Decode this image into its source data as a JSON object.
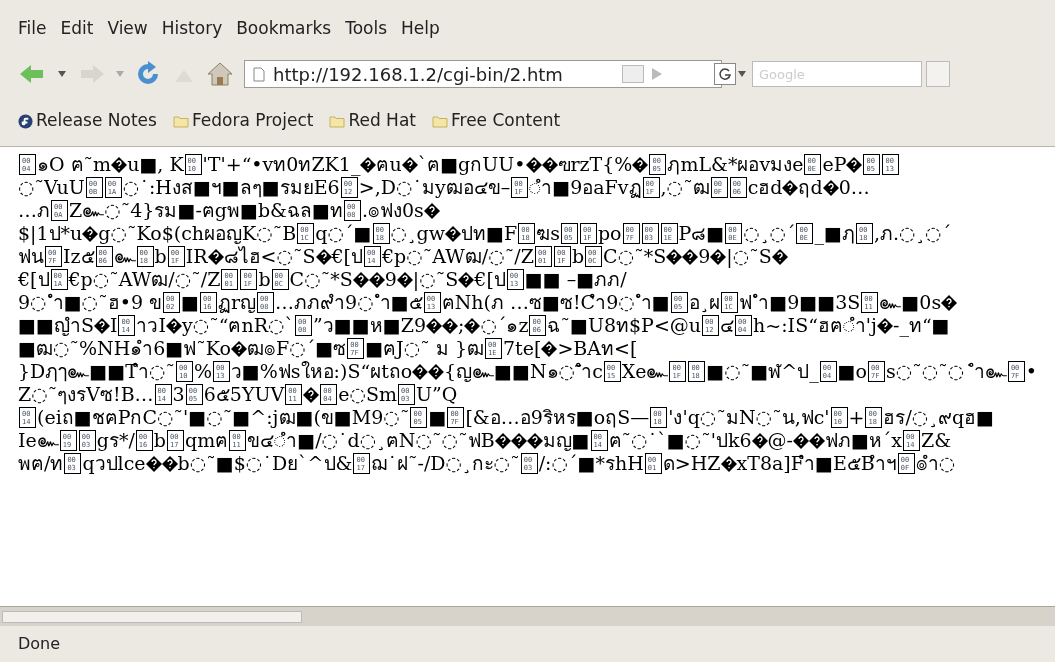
{
  "menu": [
    "File",
    "Edit",
    "View",
    "History",
    "Bookmarks",
    "Tools",
    "Help"
  ],
  "address": {
    "value": "http://192.168.1.2/cgi-bin/2.htm"
  },
  "search": {
    "placeholder": "Google"
  },
  "bookmarks": [
    {
      "label": "Release Notes",
      "kind": "fedora"
    },
    {
      "label": "Fedora Project",
      "kind": "folder"
    },
    {
      "label": "Red Hat",
      "kind": "folder"
    },
    {
      "label": "Free Content",
      "kind": "folder"
    }
  ],
  "lines": [
    [
      {
        "kind": "hex",
        "code": "0004"
      },
      "๑O ฅ˜m",
      {
        "kind": "bad"
      },
      "u■, K",
      {
        "kind": "hex",
        "code": "0010"
      },
      "'T'+“•vท0ทZK1_",
      {
        "kind": "bad"
      },
      "ฅu",
      {
        "kind": "bad"
      },
      "`ฅ■gกUU•",
      {
        "kind": "bad"
      },
      {
        "kind": "bad"
      },
      "ฃrzT{%",
      {
        "kind": "bad"
      },
      {
        "kind": "hex",
        "code": "0005"
      },
      "ฦmL&*ผอvมงe",
      {
        "kind": "hex",
        "code": "000E"
      },
      "eP",
      {
        "kind": "bad"
      },
      {
        "kind": "hex",
        "code": "0005"
      },
      {
        "kind": "hex",
        "code": "0013"
      }
    ],
    [
      "◌˜VuU",
      {
        "kind": "hex",
        "code": "000B"
      },
      {
        "kind": "hex",
        "code": "001A"
      },
      "◌˙:Hงส■ฯ■ลๆ■รมยE6",
      {
        "kind": "hex",
        "code": "0012"
      },
      ">,D◌˙มyฒอ๔ข–",
      {
        "kind": "hex",
        "code": "001F"
      },
      " ◌ำ■9อaFvฏ",
      {
        "kind": "hex",
        "code": "001F"
      },
      ",◌˜ฒ",
      {
        "kind": "hex",
        "code": "000F"
      },
      {
        "kind": "hex",
        "code": "0006"
      },
      "cฮd",
      {
        "kind": "bad"
      },
      "ฤd",
      {
        "kind": "bad"
      },
      "0…"
    ],
    [
      "…ภ",
      {
        "kind": "hex",
        "code": "000A"
      },
      "Z๛◌˜4}รม■-ฅgพ■b&ฉล■ท",
      {
        "kind": "hex",
        "code": "0008"
      },
      ".๏ฟง0s",
      {
        "kind": "bad"
      }
    ],
    [
      "$|1ป*u",
      {
        "kind": "bad"
      },
      "g◌˜Ko$(chผอญK◌˜B",
      {
        "kind": "hex",
        "code": "001C"
      },
      "q◌´■",
      {
        "kind": "hex",
        "code": "0018"
      },
      "◌¸gw",
      {
        "kind": "bad"
      },
      "ปท■F",
      {
        "kind": "hex",
        "code": "0018"
      },
      "ฆs",
      {
        "kind": "hex",
        "code": "0005"
      },
      {
        "kind": "hex",
        "code": "001F"
      },
      "po",
      {
        "kind": "hex",
        "code": "007F"
      },
      {
        "kind": "hex",
        "code": "0003"
      },
      {
        "kind": "hex",
        "code": "001E"
      },
      "P๘■",
      {
        "kind": "hex",
        "code": "000E"
      },
      "◌¸◌´",
      {
        "kind": "hex",
        "code": "000E"
      },
      "_■ฦ",
      {
        "kind": "hex",
        "code": "0018"
      },
      ",ภ.◌¸◌´"
    ],
    [
      "ฟน",
      {
        "kind": "hex",
        "code": "007F"
      },
      "Iz๕",
      {
        "kind": "hex",
        "code": "0006"
      },
      "๛",
      {
        "kind": "hex",
        "code": "0018"
      },
      "b",
      {
        "kind": "hex",
        "code": "001F"
      },
      "IR",
      {
        "kind": "bad"
      },
      "๘ไฮ<◌˜S",
      {
        "kind": "bad"
      },
      " €[ป",
      {
        "kind": "hex",
        "code": "0014"
      },
      "€p◌˜AWฒ/◌˜/Z",
      {
        "kind": "hex",
        "code": "0001"
      },
      {
        "kind": "hex",
        "code": "001F"
      },
      "b",
      {
        "kind": "hex",
        "code": "000C"
      },
      "C◌˜*S",
      {
        "kind": "bad"
      },
      {
        "kind": "bad"
      },
      "9",
      {
        "kind": "bad"
      },
      "|◌˜S",
      {
        "kind": "bad"
      }
    ],
    [
      "€[ป",
      {
        "kind": "hex",
        "code": "001A"
      },
      "€p◌˜AWฒ/◌˜/Z",
      {
        "kind": "hex",
        "code": "0001"
      },
      {
        "kind": "hex",
        "code": "001F"
      },
      "b",
      {
        "kind": "hex",
        "code": "000C"
      },
      "C◌˜*S",
      {
        "kind": "bad"
      },
      {
        "kind": "bad"
      },
      "9",
      {
        "kind": "bad"
      },
      "|◌˜S",
      {
        "kind": "bad"
      },
      " €[ป",
      {
        "kind": "hex",
        "code": "0013"
      },
      "■■ –■ภภ/"
    ],
    [
      "9◌`ำ■◌˜ฮ•9 ข",
      {
        "kind": "hex",
        "code": "0002"
      },
      "■",
      {
        "kind": "hex",
        "code": "0016"
      },
      "ฏrญ",
      {
        "kind": "hex",
        "code": "0008"
      },
      "…ภภ๙ำ9◌`ำ■๕",
      {
        "kind": "hex",
        "code": "0013"
      },
      "ฅNh(ภ …ซ■ซ!Cำ9◌`ำ■",
      {
        "kind": "hex",
        "code": "0005"
      },
      "อ¸ผ",
      {
        "kind": "hex",
        "code": "001C"
      },
      "ฟ`ำ■9■■3S",
      {
        "kind": "hex",
        "code": "0011"
      },
      "๛■0s",
      {
        "kind": "bad"
      }
    ],
    [
      "■■ญำS",
      {
        "kind": "bad"
      },
      "I",
      {
        "kind": "hex",
        "code": "0014"
      },
      "าวI",
      {
        "kind": "bad"
      },
      "y◌˜“ฅnR◌`",
      {
        "kind": "hex",
        "code": "0008"
      },
      "”ว■■ห■Z9",
      {
        "kind": "bad"
      },
      {
        "kind": "bad"
      },
      ";",
      {
        "kind": "bad"
      },
      "◌´๑z",
      {
        "kind": "hex",
        "code": "0006"
      },
      "ฉ˜■U8ท$P<@u",
      {
        "kind": "hex",
        "code": "0012"
      },
      "๔",
      {
        "kind": "hex",
        "code": "0004"
      },
      " h~:IS“ฮฅ◌ำ'j",
      {
        "kind": "bad"
      },
      "-_ท“■"
    ],
    [
      "■ฒ◌˜%NH๑ำ6■ฟ˜Ko",
      {
        "kind": "bad"
      },
      "ฒ๏F◌´■ซ",
      {
        "kind": "hex",
        "code": "007F"
      },
      "■ฅJ◌˜ ม }ฒ",
      {
        "kind": "hex",
        "code": "001E"
      },
      "7te[",
      {
        "kind": "bad"
      },
      ">BAท<["
    ],
    [
      "}Dฦๅ๛■■Tำ◌˜",
      {
        "kind": "hex",
        "code": "0010"
      },
      "%",
      {
        "kind": "hex",
        "code": "0013"
      },
      "ว■%ฟsใหอ:)S“ผtถo",
      {
        "kind": "bad"
      },
      {
        "kind": "bad"
      },
      "{ญ๛■■N๑◌˜ำc",
      {
        "kind": "hex",
        "code": "0015"
      },
      "Xe๛",
      {
        "kind": "hex",
        "code": "001F"
      },
      {
        "kind": "hex",
        "code": "0018"
      },
      "■◌˜■ฬ^ป_",
      {
        "kind": "hex",
        "code": "0004"
      },
      "■o",
      {
        "kind": "hex",
        "code": "007F"
      },
      "s◌˜◌˜◌˙ำ๛",
      {
        "kind": "hex",
        "code": "007F"
      },
      "•"
    ],
    [
      "Z◌˜ๆงรVซ!B… ",
      {
        "kind": "hex",
        "code": "0014"
      },
      "3 ",
      {
        "kind": "hex",
        "code": "0005"
      },
      "6๕5YUV",
      {
        "kind": "hex",
        "code": "0011"
      },
      {
        "kind": "bad"
      },
      {
        "kind": "hex",
        "code": "0004"
      },
      "e◌Sm",
      {
        "kind": "hex",
        "code": "0003"
      },
      "U”Q"
    ],
    [
      {
        "kind": "hex",
        "code": "0014"
      },
      "(eiถ■ชฅPกC◌˜'■◌˜■^:jฒ■(ข■M9◌˜",
      {
        "kind": "hex",
        "code": "0005"
      },
      "■",
      {
        "kind": "hex",
        "code": "007F"
      },
      "[&อ…อ9ริหร■oฤS—",
      {
        "kind": "hex",
        "code": "0018"
      },
      "'ง'q◌˜มN◌˜น,ฟc'",
      {
        "kind": "hex",
        "code": "0010"
      },
      "+",
      {
        "kind": "hex",
        "code": "0018"
      },
      "ฮร/◌¸๙qฮ■"
    ],
    [
      "Ie๛",
      {
        "kind": "hex",
        "code": "0019"
      },
      {
        "kind": "hex",
        "code": "0003"
      },
      "gร*/",
      {
        "kind": "hex",
        "code": "0016"
      },
      "b",
      {
        "kind": "hex",
        "code": "0017"
      },
      "qmฅ",
      {
        "kind": "hex",
        "code": "0011"
      },
      "ข๔◌ำ■/◌˙d◌¸ฅN◌˜◌˜ฟB",
      {
        "kind": "bad"
      },
      {
        "kind": "bad"
      },
      {
        "kind": "bad"
      },
      "มญ■",
      {
        "kind": "hex",
        "code": "0014"
      },
      "ฅ˜◌˙`■◌˜'ปk6",
      {
        "kind": "bad"
      },
      "@-",
      {
        "kind": "bad"
      },
      {
        "kind": "bad"
      },
      "ฟภ■ห´x",
      {
        "kind": "hex",
        "code": "0014"
      },
      "Z&"
    ],
    [
      "พฅ/ท",
      {
        "kind": "hex",
        "code": "0003"
      },
      "qวปlce",
      {
        "kind": "bad"
      },
      {
        "kind": "bad"
      },
      "b◌˜■$◌˙Dย`^ป&",
      {
        "kind": "hex",
        "code": "0017"
      },
      "ฌ˙ฝ˜-/D◌¸กะ◌˜",
      {
        "kind": "hex",
        "code": "0003"
      },
      "/:◌´■*รhH",
      {
        "kind": "hex",
        "code": "0001"
      },
      "ด>HZ",
      {
        "kind": "bad"
      },
      "xT8a]Fำ■E๕Bำฯ",
      {
        "kind": "hex",
        "code": "000F"
      },
      "๏ำ◌"
    ]
  ],
  "status": "Done"
}
